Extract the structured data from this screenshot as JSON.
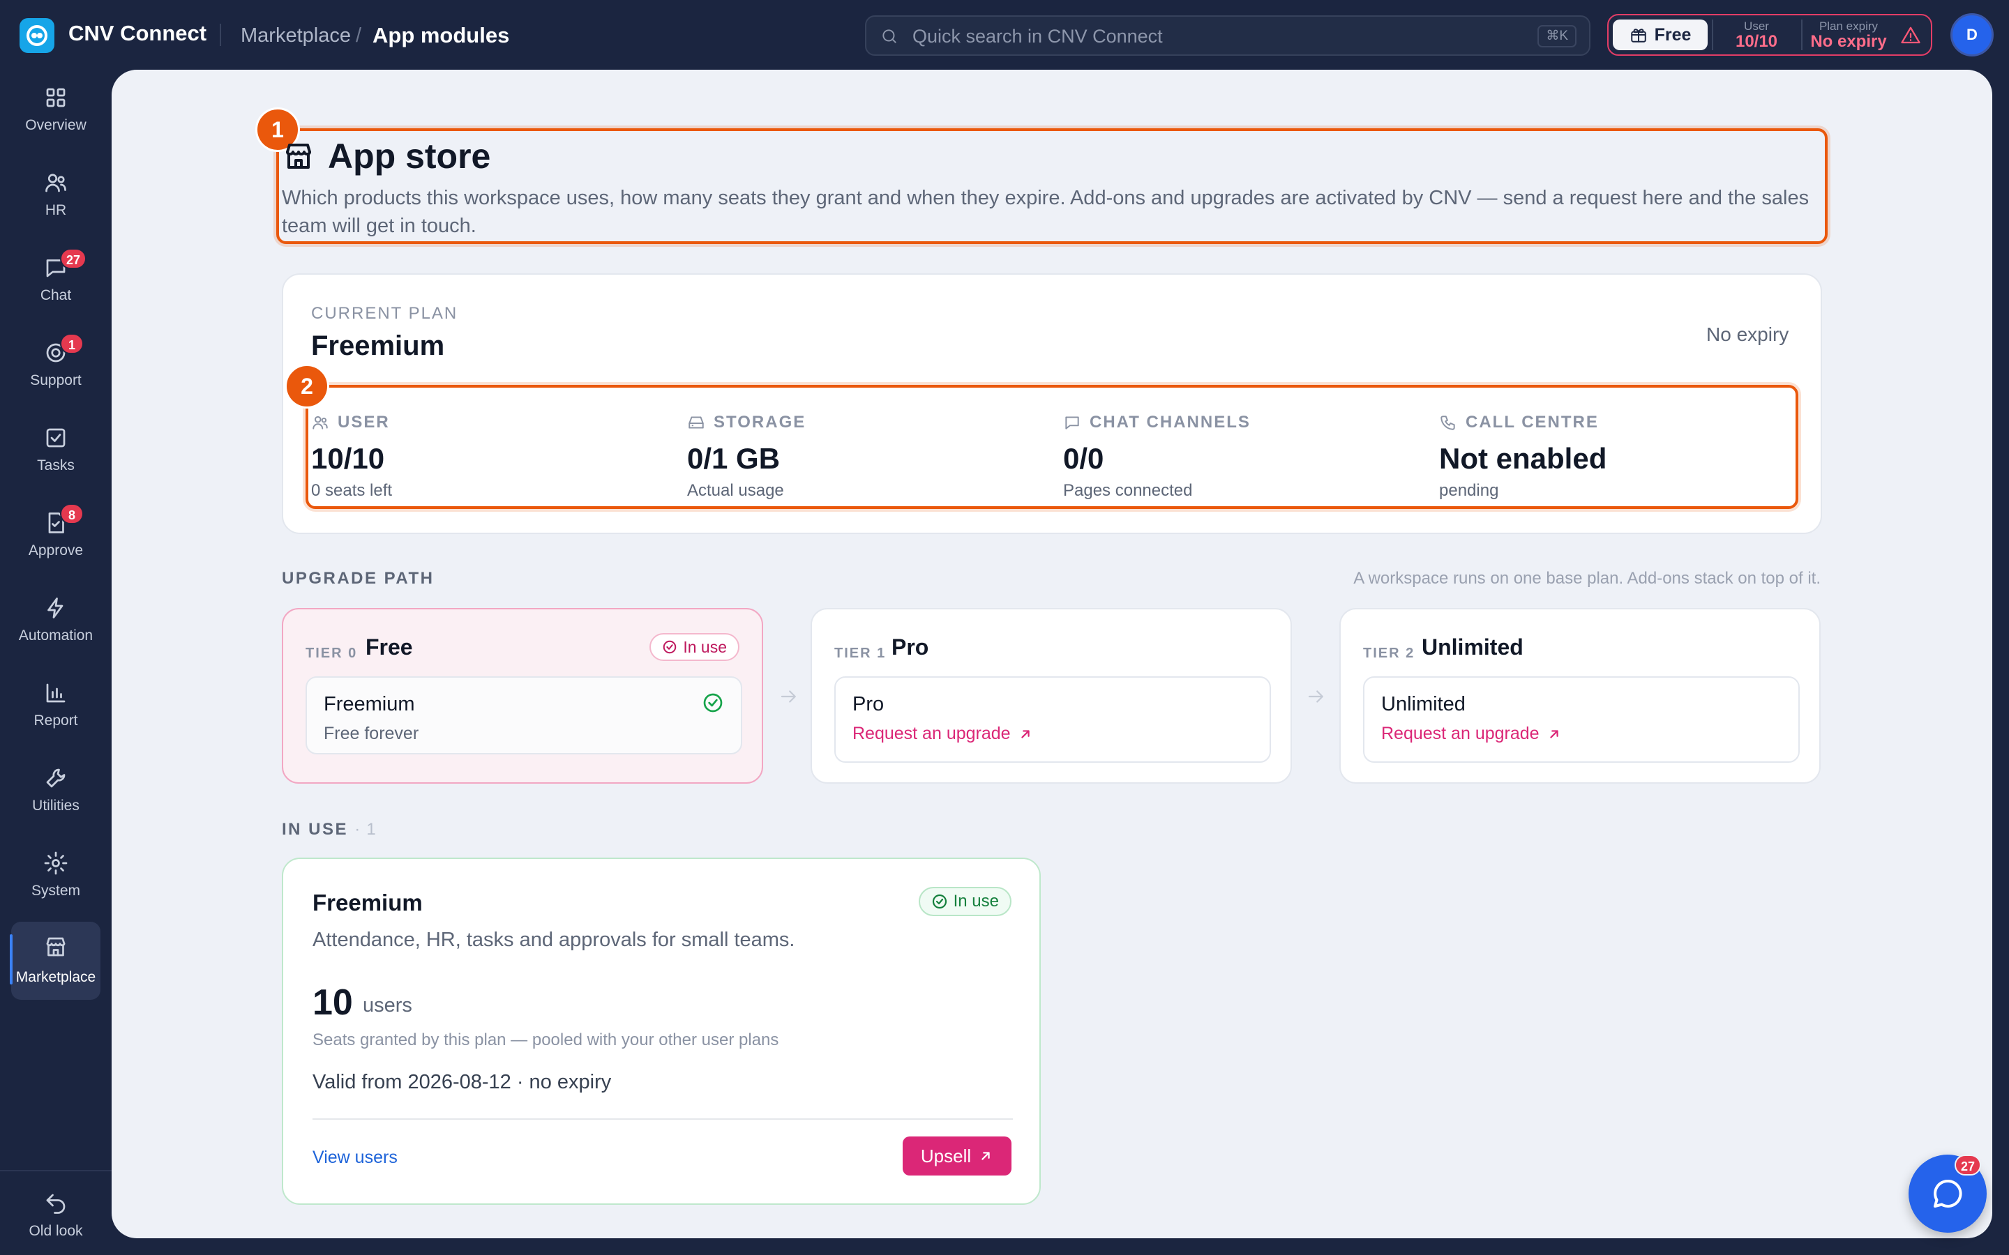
{
  "app": {
    "name": "CNV Connect"
  },
  "breadcrumb": {
    "parent": "Marketplace",
    "separator": "/",
    "current": "App modules"
  },
  "search": {
    "placeholder": "Quick search in CNV Connect",
    "shortcut": "⌘K"
  },
  "plan_status": {
    "plan": "Free",
    "user_label": "User",
    "user_value": "10/10",
    "expiry_label": "Plan expiry",
    "expiry_value": "No expiry",
    "accent": "#e33d66"
  },
  "avatar": {
    "initial": "D",
    "color": "#2563eb"
  },
  "sidebar": {
    "items": [
      {
        "label": "Overview",
        "icon": "grid-icon"
      },
      {
        "label": "HR",
        "icon": "users-icon"
      },
      {
        "label": "Chat",
        "icon": "chat-icon",
        "badge": "27"
      },
      {
        "label": "Support",
        "icon": "support-icon",
        "badge": "1"
      },
      {
        "label": "Tasks",
        "icon": "checkbox-icon"
      },
      {
        "label": "Approve",
        "icon": "approve-icon",
        "badge": "8"
      },
      {
        "label": "Automation",
        "icon": "bolt-icon"
      },
      {
        "label": "Report",
        "icon": "bar-chart-icon"
      },
      {
        "label": "Utilities",
        "icon": "wrench-icon"
      },
      {
        "label": "System",
        "icon": "gear-icon"
      },
      {
        "label": "Marketplace",
        "icon": "store-icon",
        "active": true
      }
    ],
    "footer": {
      "label": "Old look",
      "icon": "undo-icon"
    }
  },
  "annotations": {
    "marker_1": "1",
    "marker_2": "2",
    "color": "#ea580c"
  },
  "page": {
    "title": "App store",
    "description": "Which products this workspace uses, how many seats they grant and when they expire. Add-ons and upgrades are activated by CNV — send a request here and the sales team will get in touch."
  },
  "current_plan": {
    "label": "CURRENT PLAN",
    "name": "Freemium",
    "expiry": "No expiry",
    "stats": [
      {
        "label": "USER",
        "value": "10/10",
        "sub": "0 seats left",
        "icon": "users-icon"
      },
      {
        "label": "STORAGE",
        "value": "0/1 GB",
        "sub": "Actual usage",
        "icon": "drive-icon"
      },
      {
        "label": "CHAT CHANNELS",
        "value": "0/0",
        "sub": "Pages connected",
        "icon": "chat-icon"
      },
      {
        "label": "CALL CENTRE",
        "value": "Not enabled",
        "sub": "pending",
        "icon": "phone-icon"
      }
    ]
  },
  "upgrade_path": {
    "title": "UPGRADE PATH",
    "note": "A workspace runs on one base plan. Add-ons stack on top of it.",
    "tiers": [
      {
        "tier": "TIER 0",
        "name": "Free",
        "status": "In use",
        "product": "Freemium",
        "sub": "Free forever"
      },
      {
        "tier": "TIER 1",
        "name": "Pro",
        "product": "Pro",
        "action": "Request an upgrade"
      },
      {
        "tier": "TIER 2",
        "name": "Unlimited",
        "product": "Unlimited",
        "action": "Request an upgrade"
      }
    ]
  },
  "in_use": {
    "title": "IN USE",
    "separator": "·",
    "count": "1",
    "card": {
      "name": "Freemium",
      "status": "In use",
      "description": "Attendance, HR, tasks and approvals for small teams.",
      "quantity": "10",
      "unit": "users",
      "grant_note": "Seats granted by this plan — pooled with your other user plans",
      "validity": "Valid from 2026-08-12 · no expiry",
      "view_link": "View users",
      "upsell_label": "Upsell"
    }
  },
  "chat_fab": {
    "badge": "27"
  },
  "colors": {
    "brand_pink": "#db2777",
    "success": "#15803d",
    "link": "#1d63d9",
    "sidebar_bg": "#1b2540"
  }
}
